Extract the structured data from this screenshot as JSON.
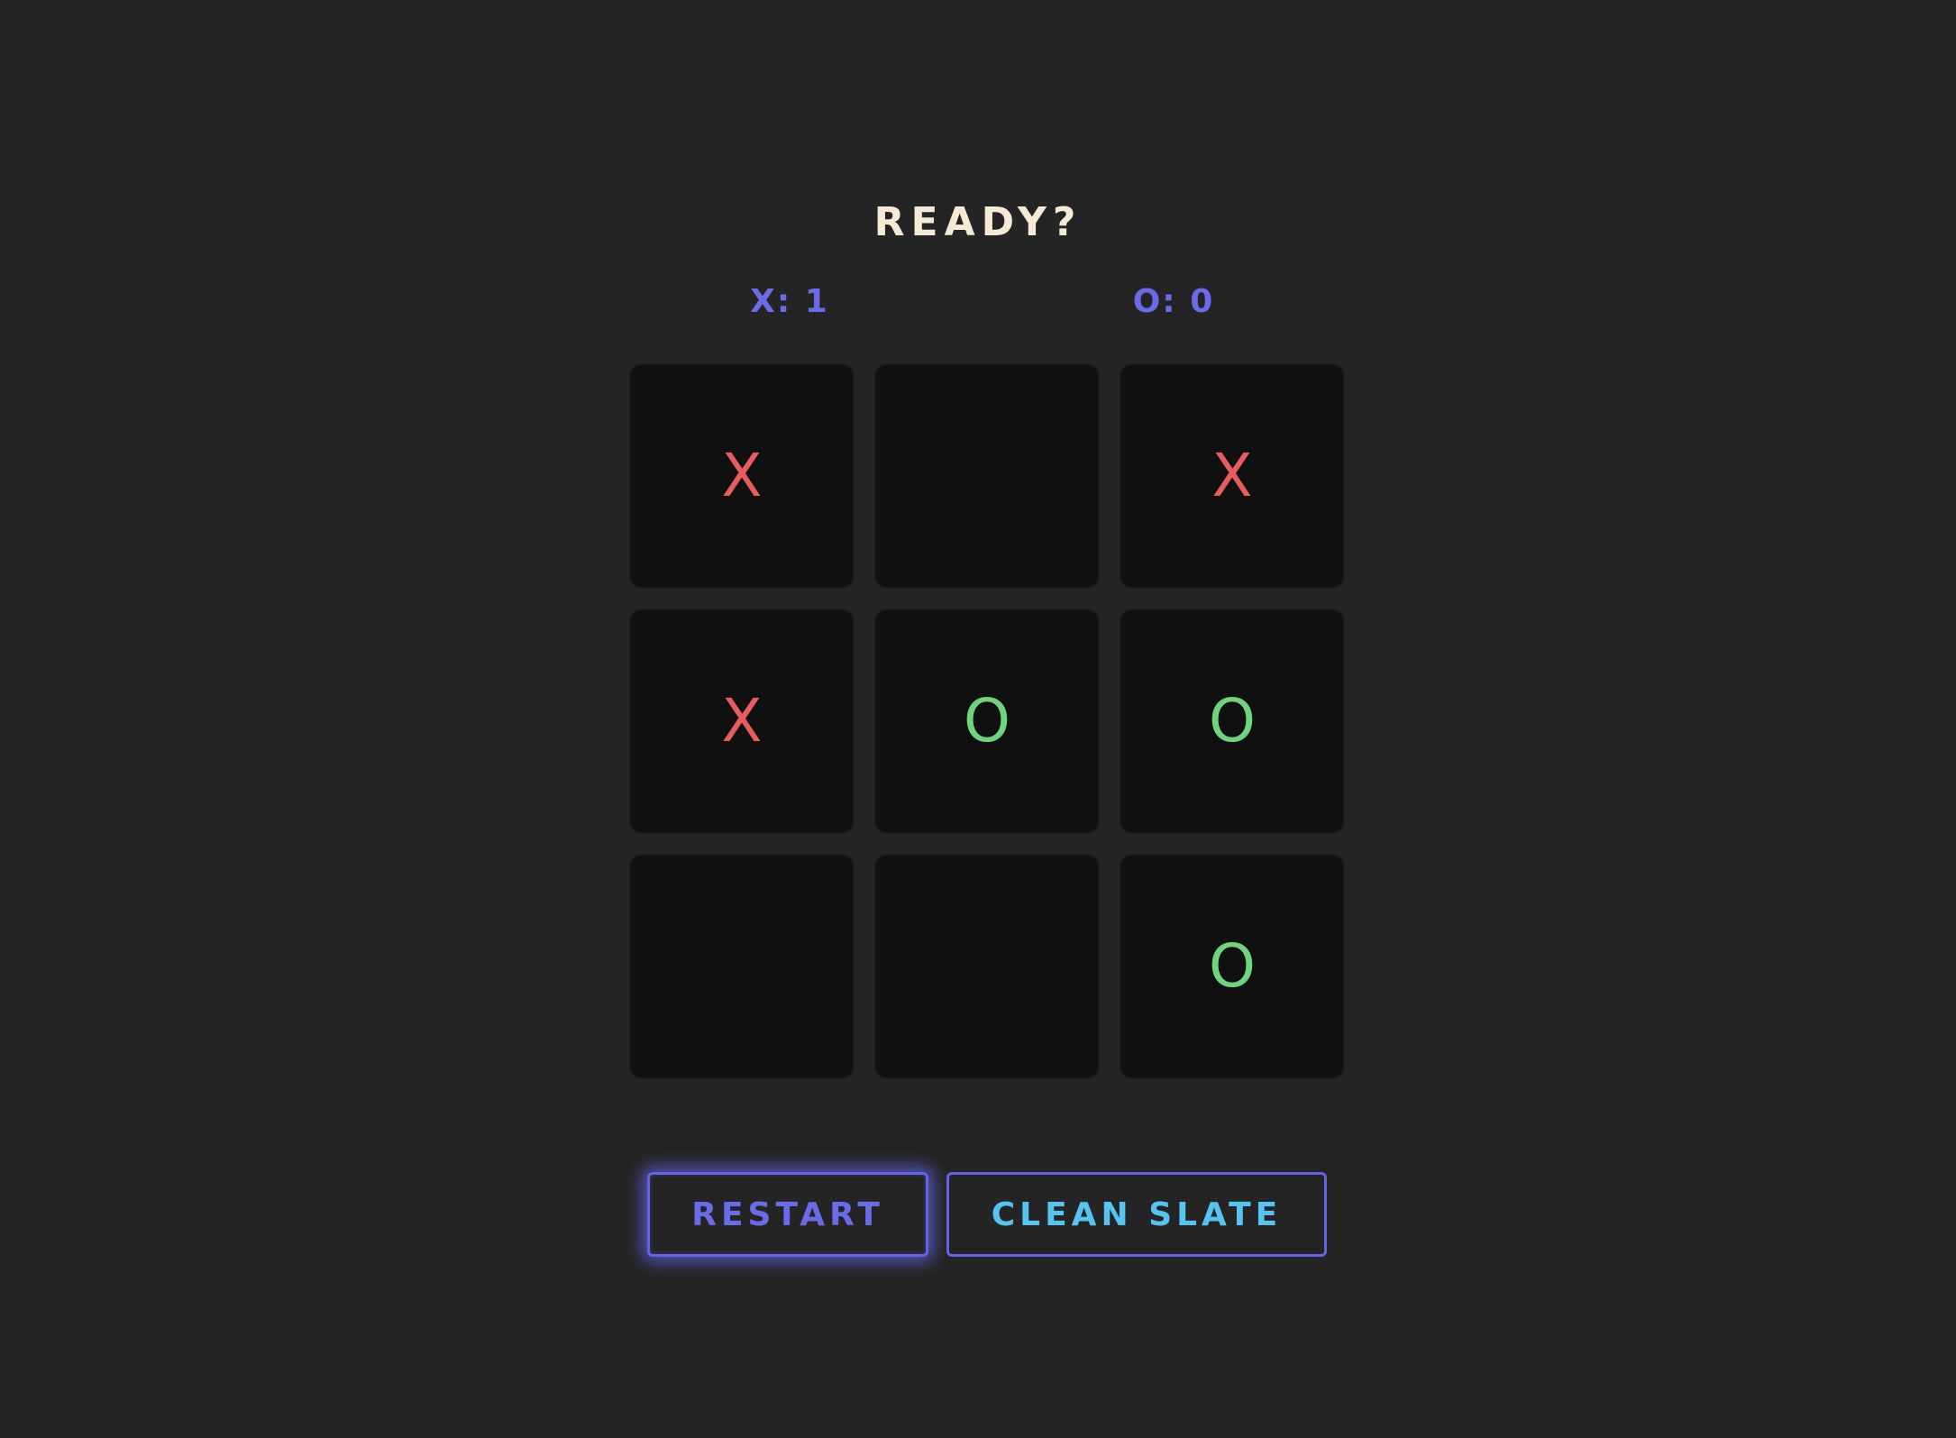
{
  "status": "READY?",
  "scores": {
    "x_label": "X: 1",
    "o_label": "O: 0"
  },
  "board": {
    "cells": [
      "X",
      "",
      "X",
      "X",
      "O",
      "O",
      "",
      "",
      "O"
    ]
  },
  "buttons": {
    "restart": "RESTART",
    "clean_slate": "CLEAN SLATE"
  },
  "colors": {
    "background": "#242424",
    "cell": "#101010",
    "x_mark": "#e85c5c",
    "o_mark": "#6fd47e",
    "accent": "#6263e6",
    "clean_slate_text": "#56c4f0",
    "status_text": "#f4ead5"
  }
}
